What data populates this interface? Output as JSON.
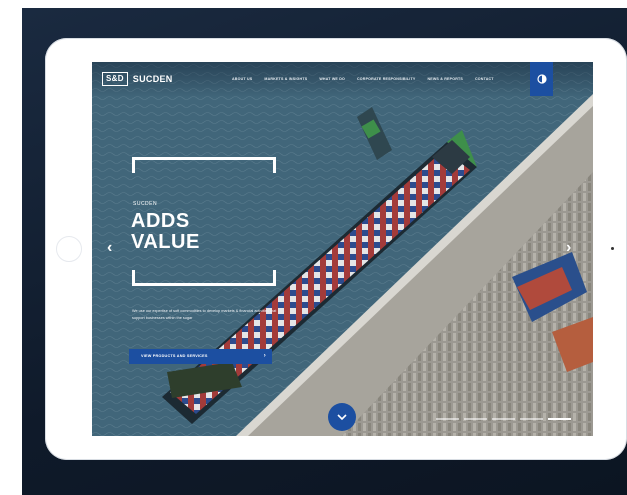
{
  "brand": {
    "logo_mark": "S&D",
    "logo_text": "SUCDEN"
  },
  "nav": {
    "items": [
      "ABOUT US",
      "MARKETS & INSIGHTS",
      "WHAT WE DO",
      "CORPORATE RESPONSIBILITY",
      "NEWS & REPORTS",
      "CONTACT"
    ]
  },
  "hero": {
    "eyebrow": "SUCDEN",
    "title_line1": "ADDS",
    "title_line2": "VALUE",
    "description": "We use our expertise of soft commodities to develop markets & financial activities that support businesses within the sugar",
    "cta_label": "VIEW PRODUCTS AND SERVICES"
  },
  "slider": {
    "dot_count": 5,
    "active_index": 4
  },
  "icons": {
    "contrast": "contrast-icon",
    "prev": "chevron-left-icon",
    "next": "chevron-right-icon",
    "scroll": "chevron-down-icon",
    "cta_arrow": "arrow-right-icon"
  },
  "colors": {
    "accent": "#1c4fa1",
    "backdrop": "#13202f",
    "sea": "#3d5f72"
  }
}
